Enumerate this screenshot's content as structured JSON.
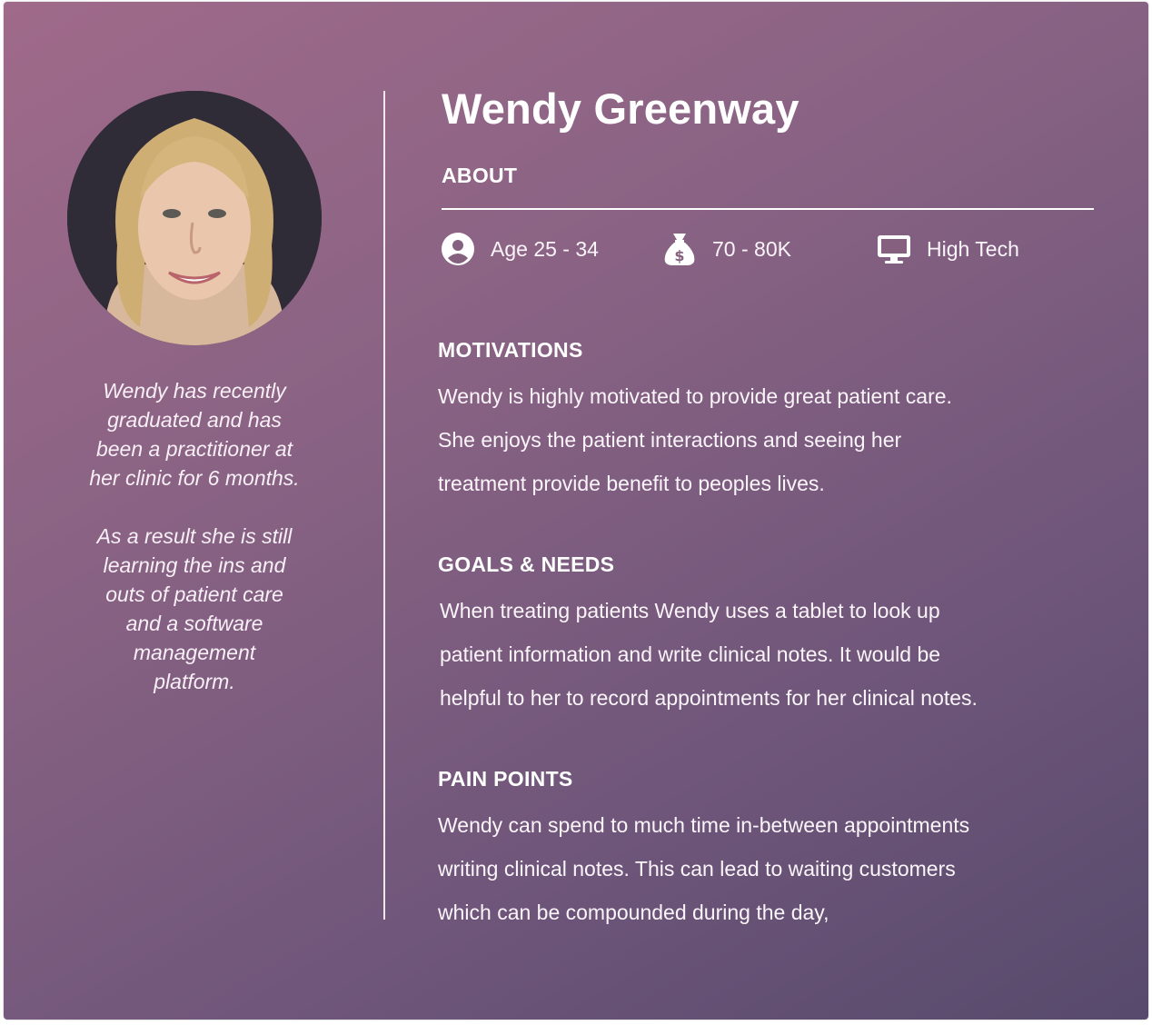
{
  "persona": {
    "name": "Wendy Greenway",
    "photo": {
      "icon": "portrait-photo",
      "alt": "Wendy Greenway portrait"
    },
    "bio": [
      "Wendy has recently\ngraduated and has\nbeen a practitioner at\nher clinic for 6 months.",
      "As a result she is still\nlearning the ins and\nouts of patient care\nand a software\nmanagement\nplatform."
    ]
  },
  "about": {
    "label": "ABOUT",
    "stats": [
      {
        "icon": "user-circle-icon",
        "text": "Age 25 - 34"
      },
      {
        "icon": "money-bag-icon",
        "text": "70 - 80K"
      },
      {
        "icon": "monitor-icon",
        "text": "High Tech"
      }
    ]
  },
  "sections": {
    "motivations": {
      "heading": "MOTIVATIONS",
      "body": "Wendy is highly motivated to provide great patient care.\nShe enjoys the patient interactions and seeing her\ntreatment provide benefit to peoples lives."
    },
    "goals": {
      "heading": "GOALS & NEEDS",
      "body": "When treating patients Wendy uses a tablet to look up\npatient information and write clinical notes. It would be\nhelpful to her to record appointments for her clinical notes."
    },
    "pain_points": {
      "heading": "PAIN POINTS",
      "body": "Wendy can spend to much time in-between appointments\nwriting clinical notes. This can lead to waiting customers\nwhich can be compounded during the day,"
    }
  },
  "colors": {
    "gradient_start": "#a06a8a",
    "gradient_end": "#574a6c",
    "text": "#ffffff"
  }
}
